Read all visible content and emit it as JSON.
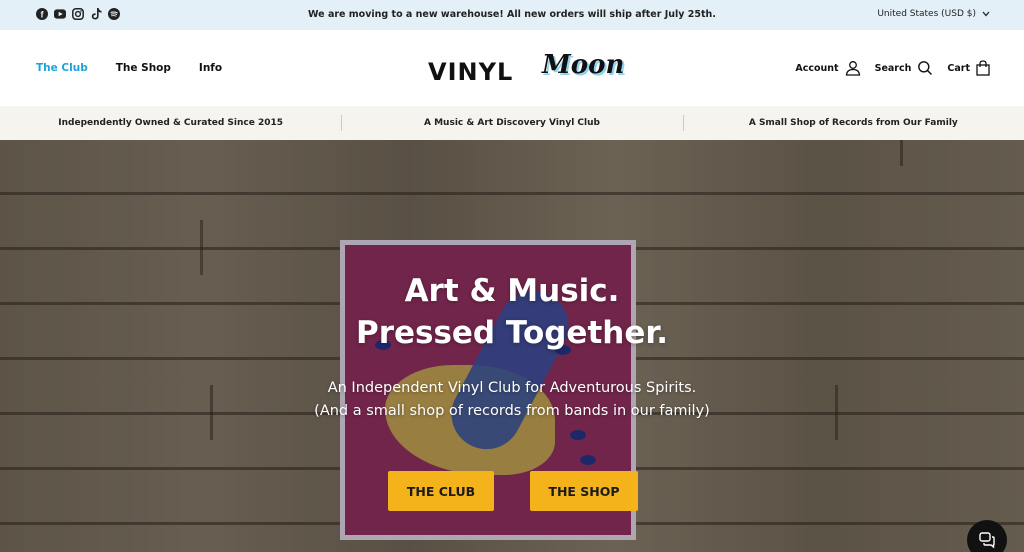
{
  "announcement": {
    "text": "We are moving to a new warehouse! All new orders will ship after July 25th.",
    "locale": "United States (USD $)",
    "social_icons": [
      "facebook-icon",
      "youtube-icon",
      "instagram-icon",
      "tiktok-icon",
      "spotify-icon"
    ]
  },
  "header": {
    "nav": [
      "The Club",
      "The Shop",
      "Info"
    ],
    "active_nav": "The Club",
    "logo_left": "VINYL",
    "logo_right": "Moon",
    "account": "Account",
    "search": "Search",
    "cart": "Cart"
  },
  "usp": [
    "Independently Owned & Curated Since 2015",
    "A Music & Art Discovery Vinyl Club",
    "A Small Shop of Records from Our Family"
  ],
  "hero": {
    "title_line1": "Art & Music.",
    "title_line2": "Pressed Together.",
    "subtitle_line1": "An Independent Vinyl Club for Adventurous Spirits.",
    "subtitle_line2": "(And a small shop of records from bands in our family)",
    "button_club": "THE CLUB",
    "button_shop": "THE SHOP"
  },
  "colors": {
    "accent_blue": "#1ea3d8",
    "button_yellow": "#f4b31a",
    "announce_bg": "#e3f0f8"
  }
}
